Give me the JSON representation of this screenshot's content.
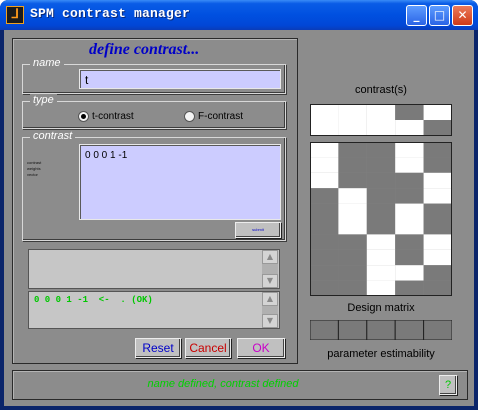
{
  "window": {
    "title": "SPM contrast manager",
    "controls": {
      "minimize": "_",
      "maximize": "□",
      "close": "✕"
    }
  },
  "define": {
    "heading": "define contrast...",
    "name_legend": "name",
    "name_value": "t",
    "type_legend": "type",
    "type_options": [
      "t-contrast",
      "F-contrast"
    ],
    "type_selected": "t-contrast",
    "contrast_legend": "contrast",
    "contrast_value": "0 0 0 1 -1",
    "side_hint_lines": [
      "contrast",
      "weights",
      "vector"
    ],
    "submit_label": "submit"
  },
  "console": {
    "line": "0 0 0 1 -1  <-  . (OK)"
  },
  "buttons": {
    "reset": "Reset",
    "cancel": "Cancel",
    "ok": "OK"
  },
  "colors": {
    "ok_text": "#c800c8",
    "cancel_text": "#c80000",
    "reset_text": "#0000c8"
  },
  "right_panel": {
    "contrasts_label": "contrast(s)",
    "design_matrix_label": "Design matrix",
    "estimability_label": "parameter estimability",
    "contrast_rows": [
      [
        1,
        1,
        1,
        0.5,
        1
      ],
      [
        1,
        1,
        1,
        1,
        0.5
      ]
    ],
    "design_matrix": [
      [
        1,
        0.5,
        0.5,
        1,
        0.5
      ],
      [
        1,
        0.5,
        0.5,
        1,
        0.5
      ],
      [
        1,
        0.5,
        0.5,
        0.5,
        1
      ],
      [
        0.5,
        1,
        0.5,
        0.5,
        1
      ],
      [
        0.5,
        1,
        0.5,
        1,
        0.5
      ],
      [
        0.5,
        1,
        0.5,
        1,
        0.5
      ],
      [
        0.5,
        0.5,
        1,
        0.5,
        1
      ],
      [
        0.5,
        0.5,
        1,
        0.5,
        1
      ],
      [
        0.5,
        0.5,
        1,
        1,
        0.5
      ],
      [
        0.5,
        0.5,
        1,
        0.5,
        0.5
      ]
    ],
    "estimability": [
      0.5,
      0.5,
      0.5,
      0.5,
      0.5
    ]
  },
  "status": {
    "text": "name defined, contrast defined",
    "help_label": "?"
  }
}
